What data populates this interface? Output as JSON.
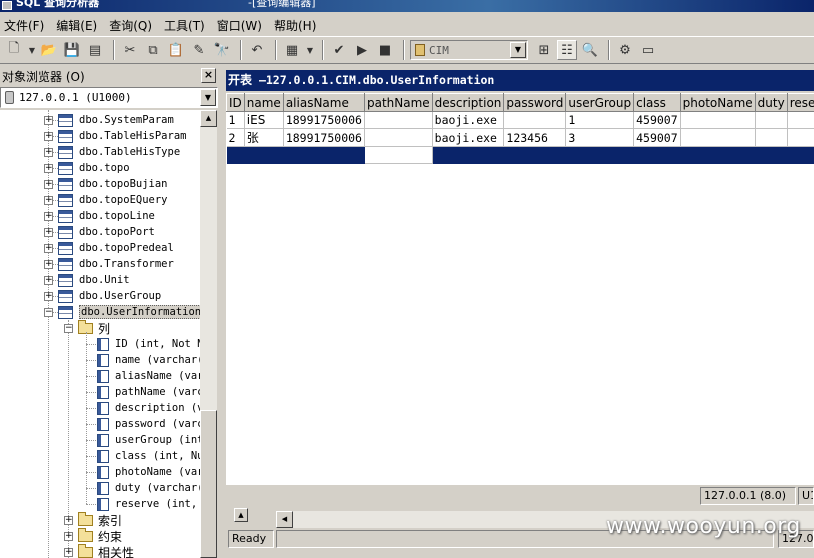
{
  "window": {
    "title": "SQL 查询分析器",
    "title_suffix": "-[查询编辑器]"
  },
  "menu": [
    "文件(F)",
    "编辑(E)",
    "查询(Q)",
    "工具(T)",
    "窗口(W)",
    "帮助(H)"
  ],
  "toolbar": {
    "database": "CIM"
  },
  "object_browser": {
    "title": "对象浏览器 (O)",
    "close": "×",
    "server": "127.0.0.1 (U1000)",
    "tables": [
      "dbo.SystemParam",
      "dbo.TableHisParam",
      "dbo.TableHisType",
      "dbo.topo",
      "dbo.topoBujian",
      "dbo.topoEQuery",
      "dbo.topoLine",
      "dbo.topoPort",
      "dbo.topoPredeal",
      "dbo.Transformer",
      "dbo.Unit",
      "dbo.UserGroup",
      "dbo.UserInformation"
    ],
    "columns_folder": "列",
    "columns": [
      "ID (int, Not N",
      "name (varchar(",
      "aliasName (var",
      "pathName (varc",
      "description (v",
      "password (varc",
      "userGroup (int",
      "class (int, Nu",
      "photoName (var",
      "duty (varchar(",
      "reserve (int,"
    ],
    "folders": [
      "索引",
      "约束",
      "相关性"
    ]
  },
  "grid": {
    "title_prefix": "开表",
    "title": " —127.0.0.1.CIM.dbo.UserInformation",
    "columns": [
      "ID",
      "name",
      "aliasName",
      "pathName",
      "description",
      "password",
      "userGroup",
      "class",
      "photoName",
      "duty",
      "reserve"
    ],
    "rows": [
      [
        "1",
        "iES",
        "18991750006",
        "",
        "baoji.exe",
        "",
        "1",
        "459007",
        "",
        "",
        ""
      ],
      [
        "2",
        "张",
        "18991750006",
        "",
        "baoji.exe",
        "123456",
        "3",
        "459007",
        "",
        "",
        ""
      ]
    ]
  },
  "status": {
    "server": "127.0.0.1 (8.0)",
    "user": "U1",
    "ready": "Ready",
    "bottom_right": "127.0"
  },
  "watermark": "www.wooyun.org"
}
